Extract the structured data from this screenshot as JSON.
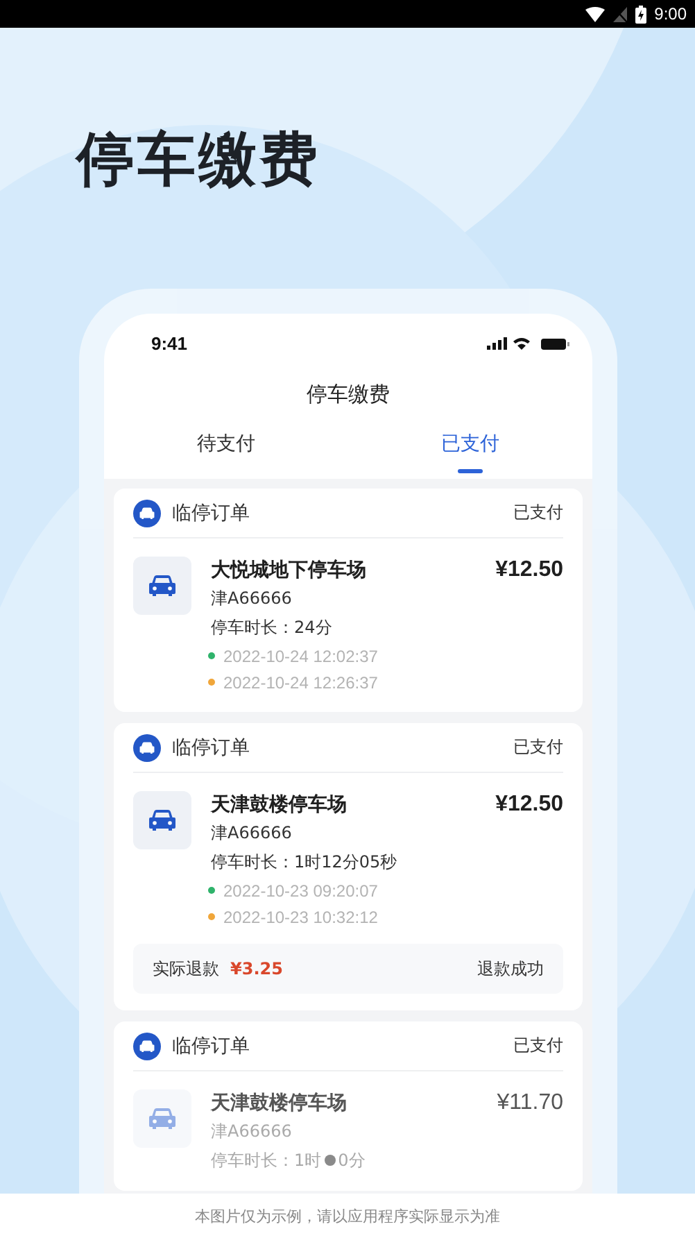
{
  "status_bar": {
    "time": "9:00"
  },
  "headline": "停车缴费",
  "phone": {
    "status_time": "9:41",
    "title": "停车缴费",
    "tabs": [
      {
        "label": "待支付",
        "selected": false
      },
      {
        "label": "已支付",
        "selected": true
      }
    ],
    "orders": [
      {
        "type_label": "临停订单",
        "status": "已支付",
        "lot": "大悦城地下停车场",
        "price": "¥12.50",
        "plate": "津A66666",
        "duration": "停车时长：24分",
        "entry_time": "2022-10-24 12:02:37",
        "exit_time": "2022-10-24 12:26:37",
        "faded": false
      },
      {
        "type_label": "临停订单",
        "status": "已支付",
        "lot": "天津鼓楼停车场",
        "price": "¥12.50",
        "plate": "津A66666",
        "duration": "停车时长：1时12分05秒",
        "entry_time": "2022-10-23 09:20:07",
        "exit_time": "2022-10-23 10:32:12",
        "refund": {
          "label": "实际退款",
          "amount": "¥3.25",
          "status": "退款成功"
        },
        "faded": false
      },
      {
        "type_label": "临停订单",
        "status": "已支付",
        "lot": "天津鼓楼停车场",
        "price": "¥11.70",
        "plate": "津A66666",
        "duration": "停车时长：1时",
        "duration_tail": "0分",
        "faded": true
      }
    ]
  },
  "caption": "本图片仅为示例，请以应用程序实际显示为准"
}
